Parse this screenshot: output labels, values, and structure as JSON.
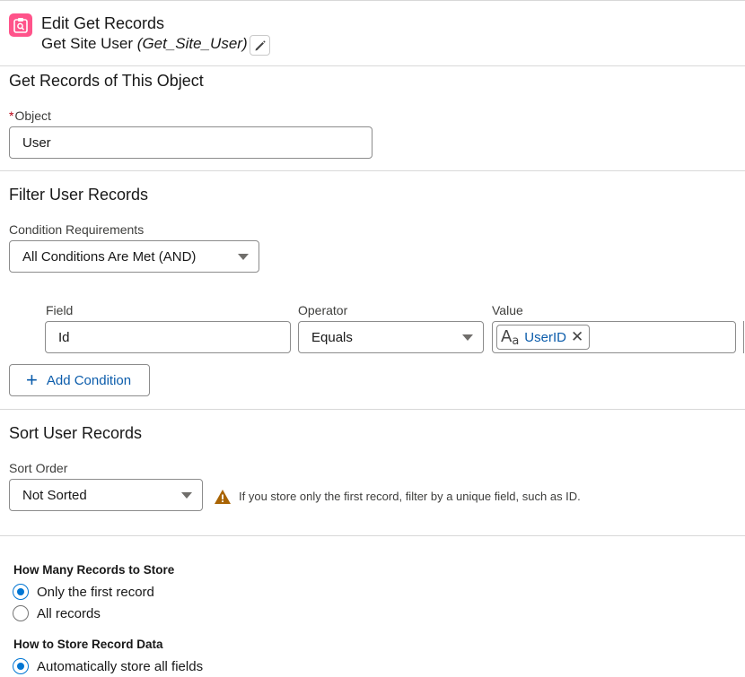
{
  "header": {
    "title": "Edit Get Records",
    "element_label": "Get Site User",
    "api_name": "(Get_Site_User)"
  },
  "object_section": {
    "title": "Get Records of This Object",
    "object_label": "Object",
    "object_value": "User"
  },
  "filter_section": {
    "title": "Filter User Records",
    "condition_label": "Condition Requirements",
    "condition_value": "All Conditions Are Met (AND)",
    "field_col": "Field",
    "operator_col": "Operator",
    "value_col": "Value",
    "condition": {
      "field": "Id",
      "operator": "Equals",
      "value_resource": "UserID"
    },
    "add_condition_label": "Add Condition"
  },
  "sort_section": {
    "title": "Sort User Records",
    "sort_order_label": "Sort Order",
    "sort_order_value": "Not Sorted",
    "warning_text": "If you store only the first record, filter by a unique field, such as ID."
  },
  "store_section": {
    "how_many_label": "How Many Records to Store",
    "how_many_options": [
      {
        "label": "Only the first record",
        "selected": true
      },
      {
        "label": "All records",
        "selected": false
      }
    ],
    "how_store_label": "How to Store Record Data",
    "how_store_options": [
      {
        "label": "Automatically store all fields",
        "selected": true
      }
    ]
  },
  "colors": {
    "brand_pink": "#ff538a",
    "link_blue": "#0b5cab",
    "radio_blue": "#0176d3",
    "warning": "#a96404"
  },
  "icons": [
    "get-records-icon",
    "edit-pencil-icon",
    "chevron-down-icon",
    "text-resource-icon",
    "remove-icon",
    "add-icon",
    "warning-icon"
  ]
}
